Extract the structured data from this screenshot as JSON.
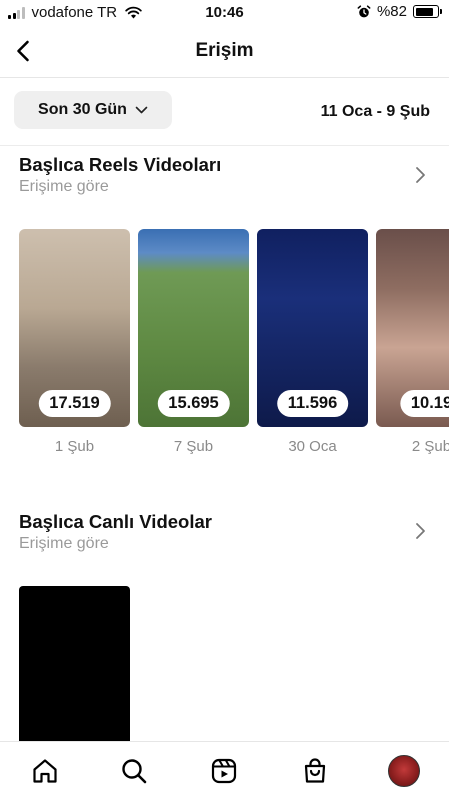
{
  "status_bar": {
    "carrier": "vodafone TR",
    "time": "10:46",
    "battery": "%82",
    "battery_level": 0.82
  },
  "header": {
    "title": "Erişim",
    "back_icon": "chevron-left-icon"
  },
  "filter": {
    "period_label": "Son 30 Gün",
    "date_range": "11 Oca - 9 Şub"
  },
  "reels_section": {
    "title": "Başlıca Reels Videoları",
    "subtitle": "Erişime göre",
    "items": [
      {
        "count": "17.519",
        "date": "1 Şub"
      },
      {
        "count": "15.695",
        "date": "7 Şub"
      },
      {
        "count": "11.596",
        "date": "30 Oca"
      },
      {
        "count": "10.19",
        "date": "2 Şub"
      }
    ]
  },
  "live_section": {
    "title": "Başlıca Canlı Videolar",
    "subtitle": "Erişime göre"
  },
  "tab_bar": {
    "tabs": [
      "home-icon",
      "search-icon",
      "reels-icon",
      "shop-icon",
      "profile-avatar"
    ]
  }
}
